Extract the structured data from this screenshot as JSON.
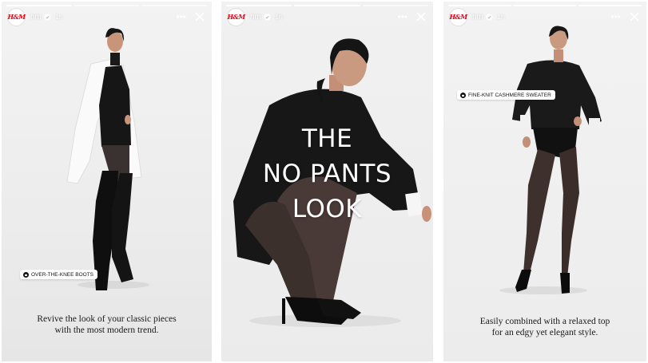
{
  "brand": {
    "accent": "#e50010",
    "logo_text": "H&M"
  },
  "stories": [
    {
      "username": "hm",
      "time": "1h",
      "progress": {
        "segments": 3,
        "completed": 1
      },
      "product_tag": "OVER-THE-KNEE BOOTS",
      "caption": [
        "Revive the look of your classic pieces",
        "with the most modern trend."
      ]
    },
    {
      "username": "hm",
      "time": "1h",
      "progress": {
        "segments": 3,
        "completed": 2
      },
      "headline": [
        "THE",
        "NO PANTS",
        "LOOK"
      ]
    },
    {
      "username": "hm",
      "time": "1h",
      "progress": {
        "segments": 3,
        "completed": 3
      },
      "product_tag": "FINE-KNIT CASHMERE SWEATER",
      "caption": [
        "Easily combined with a relaxed top",
        "for an edgy yet elegant style."
      ]
    }
  ],
  "icons": {
    "verified": "verified-badge-icon",
    "more": "more-options-icon",
    "close": "close-icon",
    "bag": "shopping-bag-icon"
  }
}
